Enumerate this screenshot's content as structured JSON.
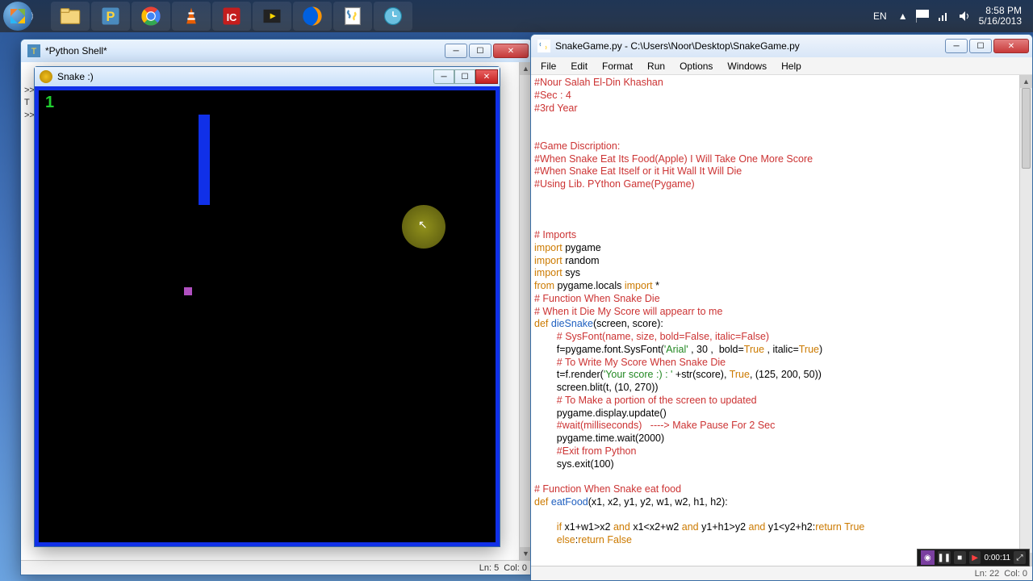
{
  "taskbar": {
    "icons": [
      "start",
      "explorer",
      "python-ide",
      "chrome",
      "vlc",
      "idm",
      "mediaplayer",
      "firefox",
      "idle",
      "clock-app"
    ],
    "lang": "EN",
    "time": "8:58 PM",
    "date": "5/16/2013"
  },
  "shell_window": {
    "title": "*Python Shell*",
    "prompt_lines": [
      ">>>",
      "T",
      ">>>",
      "",
      "",
      ">>>"
    ],
    "status_ln": "Ln: 5",
    "status_col": "Col: 0"
  },
  "game_window": {
    "title": "Snake :)",
    "score": "1"
  },
  "editor_window": {
    "title": "SnakeGame.py - C:\\Users\\Noor\\Desktop\\SnakeGame.py",
    "menu": [
      "File",
      "Edit",
      "Format",
      "Run",
      "Options",
      "Windows",
      "Help"
    ],
    "status_ln": "Ln: 22",
    "status_col": "Col: 0",
    "code": {
      "l1": "#Nour Salah El-Din Khashan",
      "l2": "#Sec : 4",
      "l3": "#3rd Year",
      "l4": "",
      "l5": "",
      "l6": "#Game Discription:",
      "l7": "#When Snake Eat Its Food(Apple) I Will Take One More Score",
      "l8": "#When Snake Eat Itself or it Hit Wall It Will Die",
      "l9": "#Using Lib. PYthon Game(Pygame)",
      "l10": "",
      "l11": "",
      "l12": "",
      "l13": "# Imports",
      "l14a": "import",
      "l14b": " pygame",
      "l15a": "import",
      "l15b": " random",
      "l16a": "import",
      "l16b": " sys",
      "l17a": "from",
      "l17b": " pygame.locals ",
      "l17c": "import",
      "l17d": " *",
      "l18": "# Function When Snake Die",
      "l19": "# When it Die My Score will appearr to me",
      "l20a": "def",
      "l20b": " ",
      "l20c": "dieSnake",
      "l20d": "(screen, score):",
      "l21": "        # SysFont(name, size, bold=False, italic=False)",
      "l22a": "        f=pygame.font.SysFont(",
      "l22b": "'Arial'",
      "l22c": " , 30 ,  bold=",
      "l22d": "True",
      "l22e": " , italic=",
      "l22f": "True",
      "l22g": ")",
      "l23": "        # To Write My Score When Snake Die",
      "l24a": "        t=f.render(",
      "l24b": "'Your score :) : '",
      "l24c": " +str(score), ",
      "l24d": "True",
      "l24e": ", (125, 200, 50))",
      "l25": "        screen.blit(t, (10, 270))",
      "l26": "        # To Make a portion of the screen to updated",
      "l27": "        pygame.display.update()",
      "l28": "        #wait(milliseconds)   ----> Make Pause For 2 Sec",
      "l29": "        pygame.time.wait(2000)",
      "l30": "        #Exit from Python",
      "l31": "        sys.exit(100)",
      "l32": "",
      "l33": "# Function When Snake eat food",
      "l34a": "def",
      "l34b": " ",
      "l34c": "eatFood",
      "l34d": "(x1, x2, y1, y2, w1, w2, h1, h2):",
      "l35": "",
      "l36a": "        ",
      "l36b": "if",
      "l36c": " x1+w1>x2 ",
      "l36d": "and",
      "l36e": " x1<x2+w2 ",
      "l36f": "and",
      "l36g": " y1+h1>y2 ",
      "l36h": "and",
      "l36i": " y1<y2+h2:",
      "l36j": "return",
      "l36k": " ",
      "l36l": "True",
      "l37a": "        ",
      "l37b": "else",
      "l37c": ":",
      "l37d": "return",
      "l37e": " ",
      "l37f": "False"
    }
  },
  "recorder": {
    "time": "0:00:11"
  }
}
